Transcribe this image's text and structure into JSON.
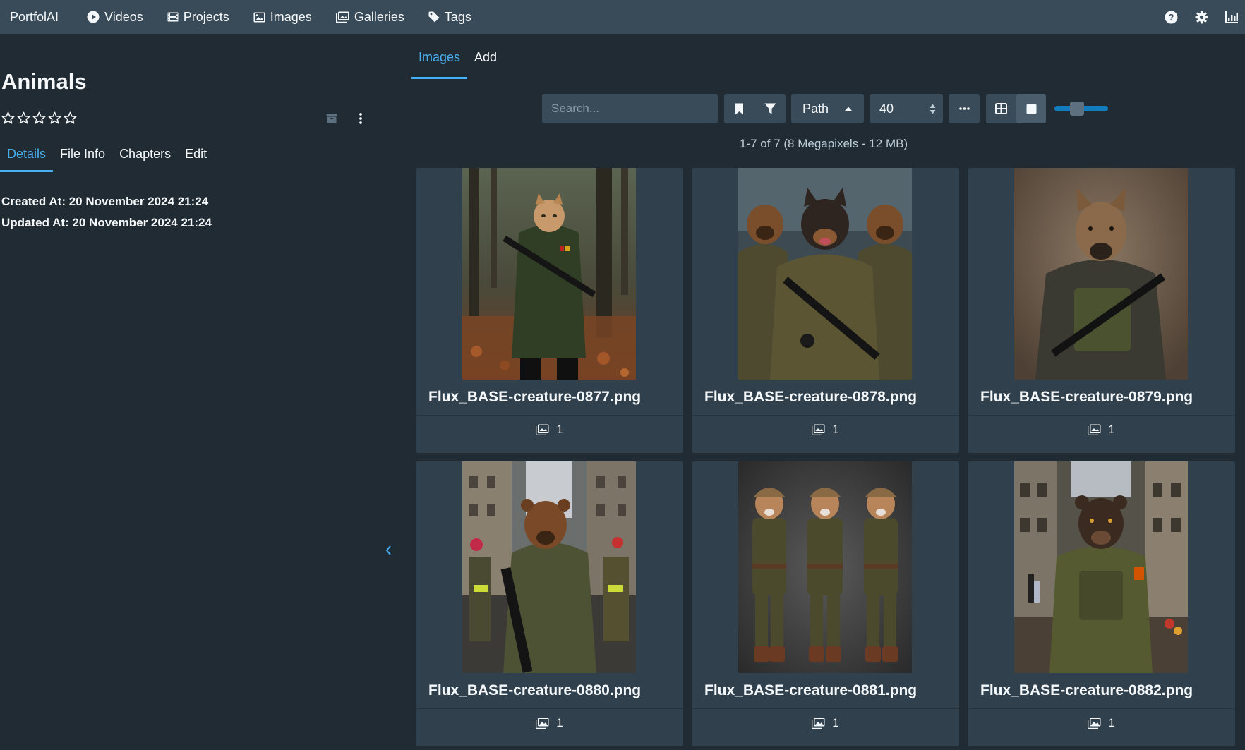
{
  "navbar": {
    "brand": "PortfolAI",
    "items": [
      {
        "label": "Videos",
        "icon": "play-circle-icon"
      },
      {
        "label": "Projects",
        "icon": "film-icon"
      },
      {
        "label": "Images",
        "icon": "image-icon"
      },
      {
        "label": "Galleries",
        "icon": "images-icon"
      },
      {
        "label": "Tags",
        "icon": "tag-icon"
      }
    ],
    "right_icons": [
      "help-icon",
      "gear-icon",
      "stats-icon"
    ]
  },
  "gallery": {
    "title": "Animals",
    "rating": {
      "stars": 5,
      "filled": 0
    },
    "tabs": [
      "Details",
      "File Info",
      "Chapters",
      "Edit"
    ],
    "active_tab": "Details",
    "created_at": "Created At: 20 November 2024 21:24",
    "updated_at": "Updated At: 20 November 2024 21:24"
  },
  "sub_tabs": [
    "Images",
    "Add"
  ],
  "active_sub_tab": "Images",
  "toolbar": {
    "search_placeholder": "Search...",
    "sort_label": "Path",
    "per_page": "40",
    "zoom_level": 0.35
  },
  "summary": "1-7 of 7 (8 Megapixels - 12 MB)",
  "images": [
    {
      "filename": "Flux_BASE-creature-0877.png",
      "count": "1",
      "subject": "cat soldier in forest"
    },
    {
      "filename": "Flux_BASE-creature-0878.png",
      "count": "1",
      "subject": "three bear soldiers"
    },
    {
      "filename": "Flux_BASE-creature-0879.png",
      "count": "1",
      "subject": "hyena soldier"
    },
    {
      "filename": "Flux_BASE-creature-0880.png",
      "count": "1",
      "subject": "bear soldier in street"
    },
    {
      "filename": "Flux_BASE-creature-0881.png",
      "count": "1",
      "subject": "three toy soldiers"
    },
    {
      "filename": "Flux_BASE-creature-0882.png",
      "count": "1",
      "subject": "bear soldier in alley"
    }
  ],
  "colors": {
    "navbar": "#394b59",
    "background": "#202b33",
    "card": "#30404d",
    "accent": "#48aff0"
  }
}
